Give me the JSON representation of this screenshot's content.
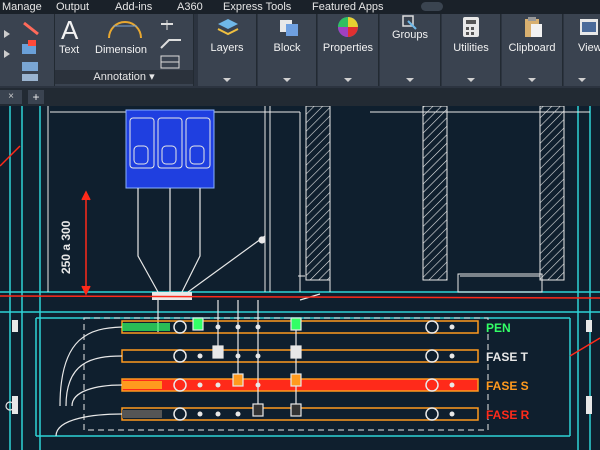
{
  "menu": [
    "Manage",
    "Output",
    "Add-ins",
    "A360",
    "Express Tools",
    "Featured Apps"
  ],
  "annotation": {
    "text_label": "Text",
    "dimension_label": "Dimension",
    "panel_title": "Annotation"
  },
  "ribbon_panels": [
    {
      "label": "Layers"
    },
    {
      "label": "Block"
    },
    {
      "label": "Properties"
    },
    {
      "label": "Groups"
    },
    {
      "label": "Utilities"
    },
    {
      "label": "Clipboard"
    },
    {
      "label": "View"
    }
  ],
  "drawing": {
    "dimension_text": "250 a 300",
    "bus_labels": [
      "PEN",
      "FASE T",
      "FASE S",
      "FASE R"
    ],
    "colors": {
      "background": "#0f1f2e",
      "cyan": "#2fd3d6",
      "red": "#ff2a1a",
      "orange": "#ff9a1e",
      "white": "#e8e8e8",
      "green": "#33ff66",
      "blue_block": "#1f3fe0"
    }
  }
}
